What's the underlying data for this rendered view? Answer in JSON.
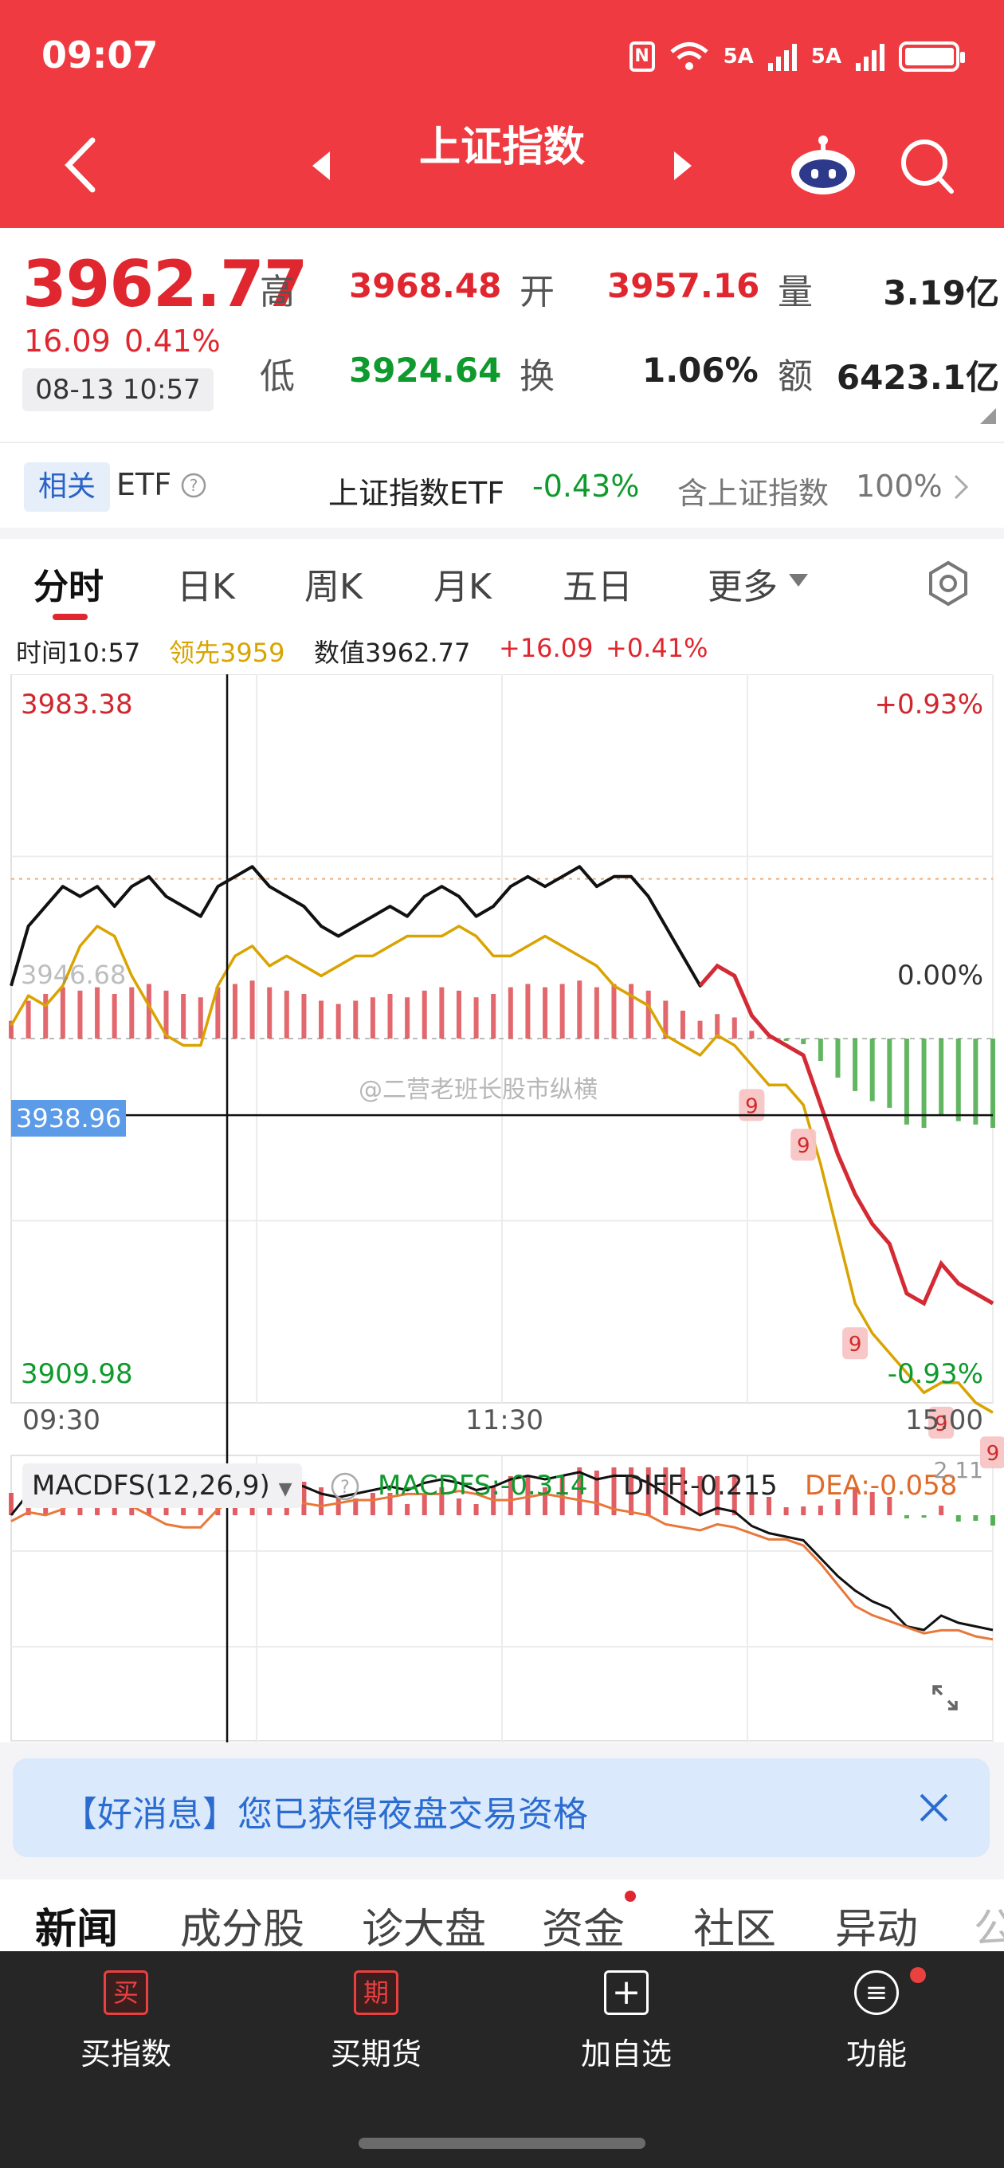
{
  "status": {
    "time": "09:07",
    "net1": "5A",
    "net2": "5A",
    "battery": 0.9
  },
  "header": {
    "title": "上证指数"
  },
  "quote": {
    "price": "3962.77",
    "change": "16.09",
    "change_pct": "0.41%",
    "datetime": "08-13 10:57",
    "high_label": "高",
    "high": "3968.48",
    "open_label": "开",
    "open": "3957.16",
    "volume_label": "量",
    "volume": "3.19亿",
    "low_label": "低",
    "low": "3924.64",
    "turnover_label": "换",
    "turnover": "1.06%",
    "amount_label": "额",
    "amount": "6423.1亿"
  },
  "etf": {
    "tag": "相关",
    "label": "ETF",
    "name": "上证指数ETF",
    "change": "-0.43%",
    "contains_label": "含上证指数",
    "contains_pct": "100%"
  },
  "tabs": [
    "分时",
    "日K",
    "周K",
    "月K",
    "五日",
    "更多"
  ],
  "info": {
    "time": "时间10:57",
    "lead": "领先3959",
    "value": "数值3962.77",
    "change": "+16.09",
    "pct": "+0.41%"
  },
  "chart_data": {
    "type": "line",
    "y_max_label": "3983.38",
    "y_min_label": "3909.98",
    "pct_max_label": "+0.93%",
    "pct_min_label": "-0.93%",
    "zero_label": "0.00%",
    "prev_close_label": "3946.68",
    "crosshair_label": "3938.96",
    "x_labels": [
      "09:30",
      "11:30",
      "15:00"
    ],
    "ylim": [
      3909.98,
      3983.38
    ],
    "watermark": "@二营老班长股市纵横",
    "series": [
      {
        "name": "数值",
        "color": "#111111",
        "values": [
          3952,
          3958,
          3960,
          3962,
          3961,
          3962,
          3960,
          3962,
          3963,
          3961,
          3960,
          3959,
          3962,
          3963,
          3964,
          3962,
          3961,
          3960,
          3958,
          3957,
          3958,
          3959,
          3960,
          3959,
          3961,
          3962,
          3961,
          3959,
          3960,
          3962,
          3963,
          3962,
          3963,
          3964,
          3962,
          3963,
          3963,
          3961,
          3958,
          3955,
          3952,
          3954,
          3953,
          3949,
          3947,
          3946,
          3945,
          3940,
          3935,
          3931,
          3928,
          3926,
          3921,
          3920,
          3924,
          3922,
          3921,
          3920
        ]
      },
      {
        "name": "领先",
        "color": "#d9a300",
        "values": [
          3948,
          3951,
          3950,
          3952,
          3956,
          3958,
          3957,
          3953,
          3950,
          3947,
          3946,
          3946,
          3952,
          3955,
          3956,
          3954,
          3955,
          3954,
          3953,
          3954,
          3955,
          3955,
          3956,
          3957,
          3957,
          3957,
          3958,
          3957,
          3955,
          3955,
          3956,
          3957,
          3956,
          3955,
          3954,
          3952,
          3951,
          3950,
          3947,
          3946,
          3945,
          3947,
          3946,
          3944,
          3942,
          3942,
          3940,
          3934,
          3927,
          3920,
          3917,
          3915,
          3913,
          3911,
          3912,
          3912,
          3910,
          3909
        ]
      }
    ],
    "signals": [
      "9",
      "9",
      "9",
      "9",
      "9"
    ],
    "macd": {
      "title": "MACDFS(12,26,9)",
      "macdfs_label": "MACDFS:",
      "macdfs": "-0.314",
      "diff_label": "DIFF:",
      "diff": "-0.215",
      "dea_label": "DEA:",
      "dea": "-0.058",
      "corner": "2.11"
    }
  },
  "banner": {
    "text": "【好消息】您已获得夜盘交易资格"
  },
  "news_tabs": [
    "新闻",
    "成分股",
    "诊大盘",
    "资金",
    "社区",
    "异动",
    "公"
  ],
  "bottom_bar": [
    {
      "icon": "买",
      "label": "买指数"
    },
    {
      "icon": "期",
      "label": "买期货"
    },
    {
      "icon": "+",
      "label": "加自选"
    },
    {
      "icon": "≡",
      "label": "功能"
    }
  ]
}
